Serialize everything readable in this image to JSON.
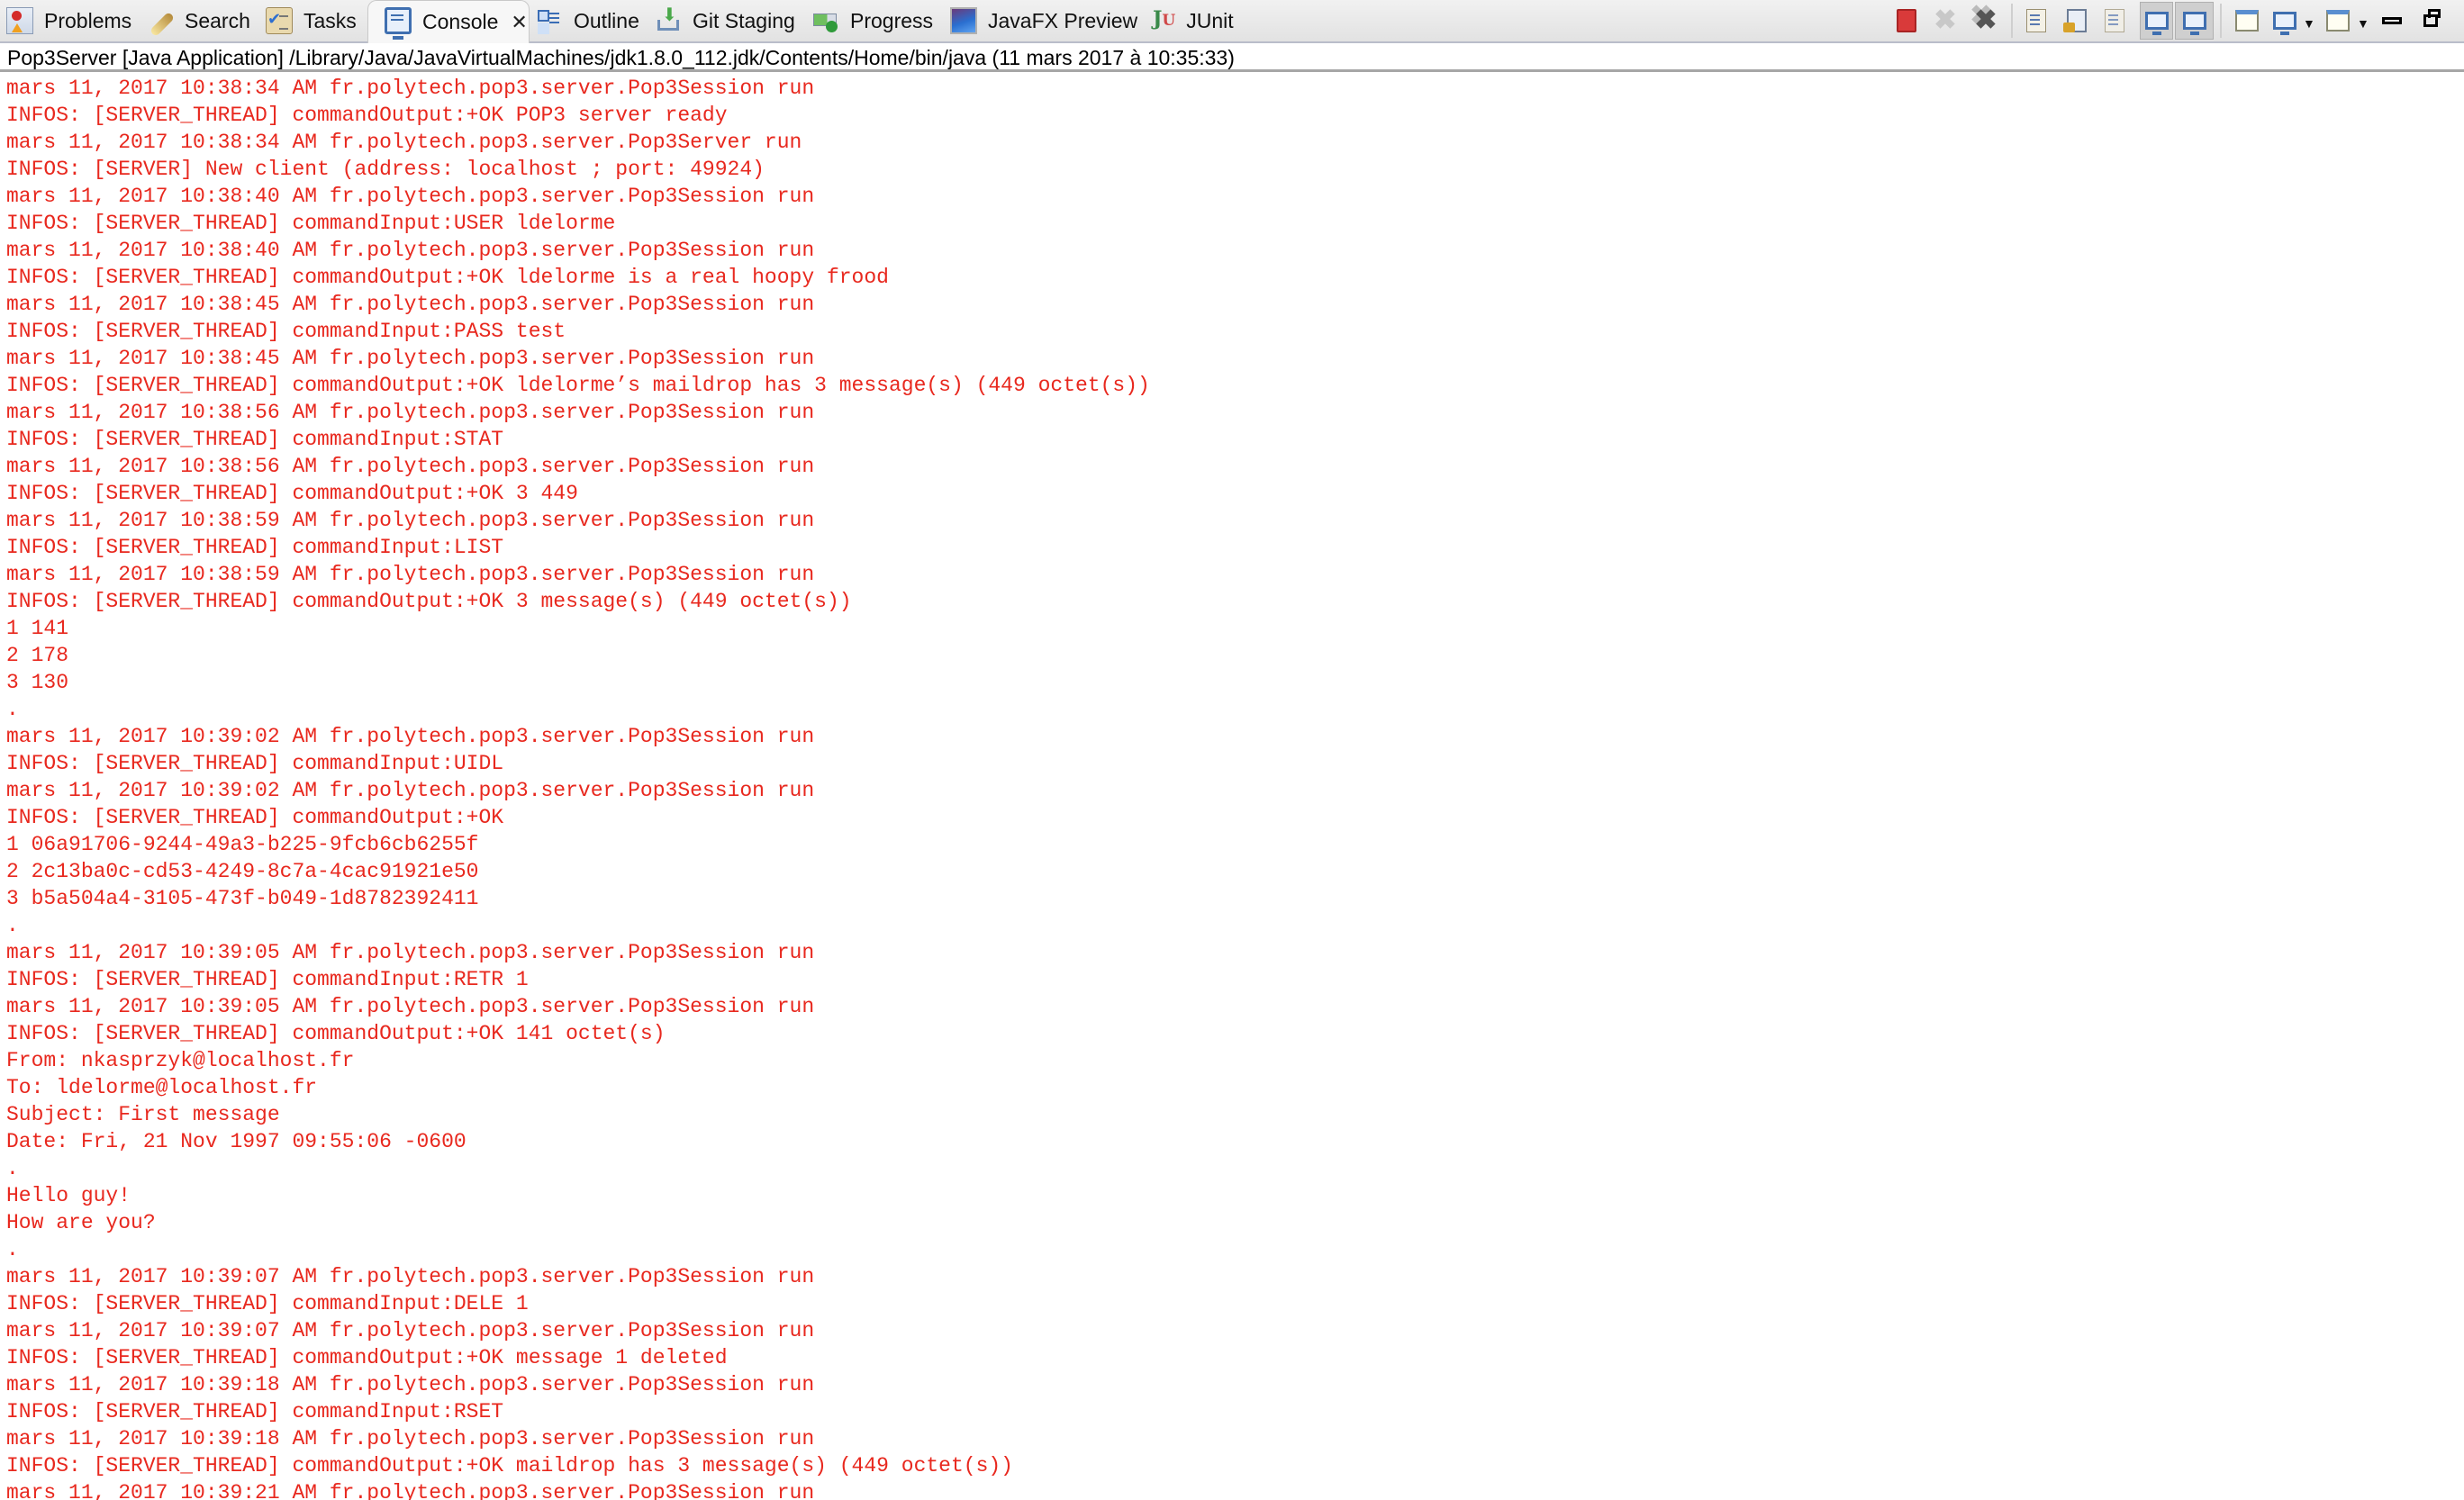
{
  "tabs": [
    {
      "label": "Problems",
      "icon": "problems-icon",
      "active": false
    },
    {
      "label": "Search",
      "icon": "search-icon",
      "active": false
    },
    {
      "label": "Tasks",
      "icon": "tasks-icon",
      "active": false
    },
    {
      "label": "Console",
      "icon": "console-icon",
      "active": true,
      "close": "✕"
    },
    {
      "label": "Outline",
      "icon": "outline-icon",
      "active": false
    },
    {
      "label": "Git Staging",
      "icon": "git-staging-icon",
      "active": false
    },
    {
      "label": "Progress",
      "icon": "progress-icon",
      "active": false
    },
    {
      "label": "JavaFX Preview",
      "icon": "javafx-preview-icon",
      "active": false
    },
    {
      "label": "JUnit",
      "icon": "junit-icon",
      "active": false,
      "glyph_j": "J",
      "glyph_u": "U"
    }
  ],
  "toolbar": {
    "items": [
      {
        "name": "terminate",
        "icon": "stop-icon",
        "enabled": true
      },
      {
        "name": "remove-launch",
        "icon": "remove-icon",
        "enabled": false,
        "glyph": "✖"
      },
      {
        "name": "remove-all-terminated",
        "icon": "remove-all-icon",
        "enabled": true,
        "glyph": "✖"
      },
      {
        "name": "clear-console",
        "icon": "clear-console-icon",
        "enabled": true
      },
      {
        "name": "scroll-lock",
        "icon": "scroll-lock-icon",
        "enabled": true
      },
      {
        "name": "word-wrap",
        "icon": "word-wrap-icon",
        "enabled": true
      },
      {
        "name": "show-console-on-stdout",
        "icon": "show-stdout-icon",
        "pressed": true
      },
      {
        "name": "show-console-on-stderr",
        "icon": "show-stderr-icon",
        "pressed": true
      },
      {
        "name": "pin-console",
        "icon": "pin-icon",
        "enabled": true
      },
      {
        "name": "display-selected-console",
        "icon": "display-console-icon",
        "dropdown": "▼"
      },
      {
        "name": "open-console",
        "icon": "open-console-icon",
        "dropdown": "▼"
      },
      {
        "name": "minimize",
        "icon": "minimize-icon"
      },
      {
        "name": "maximize",
        "icon": "maximize-icon"
      }
    ]
  },
  "process_header": "Pop3Server [Java Application] /Library/Java/JavaVirtualMachines/jdk1.8.0_112.jdk/Contents/Home/bin/java (11 mars 2017 à 10:35:33)",
  "console": {
    "text_color": "#e8281e",
    "lines": [
      "mars 11, 2017 10:38:34 AM fr.polytech.pop3.server.Pop3Session run",
      "INFOS: [SERVER_THREAD] commandOutput:+OK POP3 server ready",
      "mars 11, 2017 10:38:34 AM fr.polytech.pop3.server.Pop3Server run",
      "INFOS: [SERVER] New client (address: localhost ; port: 49924)",
      "mars 11, 2017 10:38:40 AM fr.polytech.pop3.server.Pop3Session run",
      "INFOS: [SERVER_THREAD] commandInput:USER ldelorme",
      "mars 11, 2017 10:38:40 AM fr.polytech.pop3.server.Pop3Session run",
      "INFOS: [SERVER_THREAD] commandOutput:+OK ldelorme is a real hoopy frood",
      "mars 11, 2017 10:38:45 AM fr.polytech.pop3.server.Pop3Session run",
      "INFOS: [SERVER_THREAD] commandInput:PASS test",
      "mars 11, 2017 10:38:45 AM fr.polytech.pop3.server.Pop3Session run",
      "INFOS: [SERVER_THREAD] commandOutput:+OK ldelorme’s maildrop has 3 message(s) (449 octet(s))",
      "mars 11, 2017 10:38:56 AM fr.polytech.pop3.server.Pop3Session run",
      "INFOS: [SERVER_THREAD] commandInput:STAT",
      "mars 11, 2017 10:38:56 AM fr.polytech.pop3.server.Pop3Session run",
      "INFOS: [SERVER_THREAD] commandOutput:+OK 3 449",
      "mars 11, 2017 10:38:59 AM fr.polytech.pop3.server.Pop3Session run",
      "INFOS: [SERVER_THREAD] commandInput:LIST",
      "mars 11, 2017 10:38:59 AM fr.polytech.pop3.server.Pop3Session run",
      "INFOS: [SERVER_THREAD] commandOutput:+OK 3 message(s) (449 octet(s))",
      "1 141",
      "2 178",
      "3 130",
      ".",
      "mars 11, 2017 10:39:02 AM fr.polytech.pop3.server.Pop3Session run",
      "INFOS: [SERVER_THREAD] commandInput:UIDL",
      "mars 11, 2017 10:39:02 AM fr.polytech.pop3.server.Pop3Session run",
      "INFOS: [SERVER_THREAD] commandOutput:+OK",
      "1 06a91706-9244-49a3-b225-9fcb6cb6255f",
      "2 2c13ba0c-cd53-4249-8c7a-4cac91921e50",
      "3 b5a504a4-3105-473f-b049-1d8782392411",
      ".",
      "mars 11, 2017 10:39:05 AM fr.polytech.pop3.server.Pop3Session run",
      "INFOS: [SERVER_THREAD] commandInput:RETR 1",
      "mars 11, 2017 10:39:05 AM fr.polytech.pop3.server.Pop3Session run",
      "INFOS: [SERVER_THREAD] commandOutput:+OK 141 octet(s)",
      "From: nkasprzyk@localhost.fr",
      "To: ldelorme@localhost.fr",
      "Subject: First message",
      "Date: Fri, 21 Nov 1997 09:55:06 -0600",
      ".",
      "Hello guy!",
      "How are you?",
      ".",
      "mars 11, 2017 10:39:07 AM fr.polytech.pop3.server.Pop3Session run",
      "INFOS: [SERVER_THREAD] commandInput:DELE 1",
      "mars 11, 2017 10:39:07 AM fr.polytech.pop3.server.Pop3Session run",
      "INFOS: [SERVER_THREAD] commandOutput:+OK message 1 deleted",
      "mars 11, 2017 10:39:18 AM fr.polytech.pop3.server.Pop3Session run",
      "INFOS: [SERVER_THREAD] commandInput:RSET",
      "mars 11, 2017 10:39:18 AM fr.polytech.pop3.server.Pop3Session run",
      "INFOS: [SERVER_THREAD] commandOutput:+OK maildrop has 3 message(s) (449 octet(s))",
      "mars 11, 2017 10:39:21 AM fr.polytech.pop3.server.Pop3Session run"
    ]
  }
}
